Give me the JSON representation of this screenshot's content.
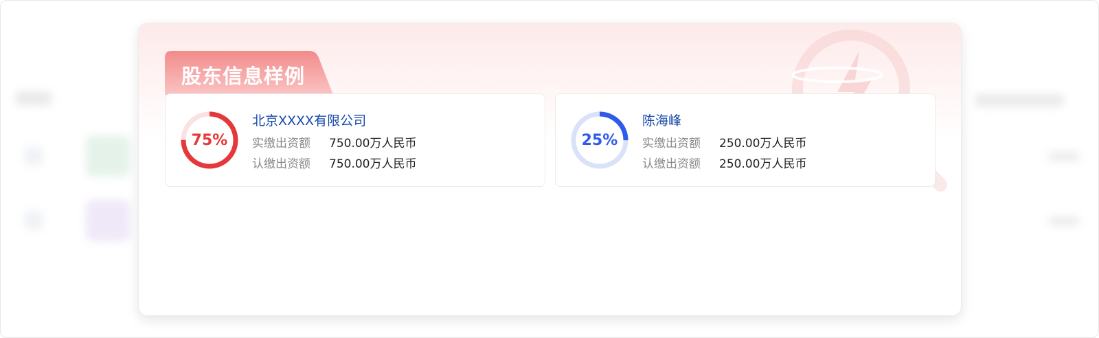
{
  "dialog": {
    "title": "股东信息样例"
  },
  "shareholders": [
    {
      "percent_label": "75%",
      "percent": 75,
      "color": "#e5383b",
      "track_color": "#fbe1e1",
      "name": "北京XXXX有限公司",
      "paid_label": "实缴出资额",
      "paid_value": "750.00万人民币",
      "subscribed_label": "认缴出资额",
      "subscribed_value": "750.00万人民币"
    },
    {
      "percent_label": "25%",
      "percent": 25,
      "color": "#2f5bea",
      "track_color": "#d9e2f8",
      "name": "陈海峰",
      "paid_label": "实缴出资额",
      "paid_value": "250.00万人民币",
      "subscribed_label": "认缴出资额",
      "subscribed_value": "250.00万人民币"
    }
  ],
  "colors": {
    "title_tab": "#f08a8a",
    "name_text": "#1649a8"
  }
}
